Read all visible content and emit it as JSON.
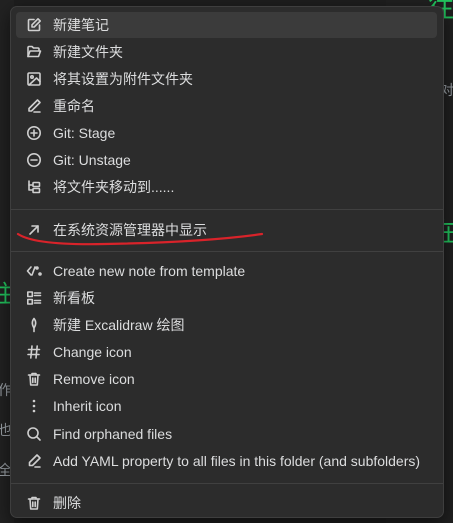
{
  "colors": {
    "menu_bg": "#2c2c2c",
    "hover_bg": "#3b3b3b",
    "text": "#dcddde",
    "separator": "#404040",
    "annotation": "#d9232a",
    "background_green": "#22c55e"
  },
  "background": {
    "glyph_top": "往",
    "glyph_mid_right": "在",
    "glyph_left": "住",
    "snippet_right": "对",
    "snippet_left_1": "作",
    "snippet_left_2": "也",
    "snippet_left_3": "全"
  },
  "menu": {
    "items": [
      {
        "label": "新建笔记",
        "icon": "edit-icon"
      },
      {
        "label": "新建文件夹",
        "icon": "folder-open-icon"
      },
      {
        "label": "将其设置为附件文件夹",
        "icon": "image-icon"
      },
      {
        "label": "重命名",
        "icon": "pencil-icon"
      },
      {
        "label": "Git: Stage",
        "icon": "plus-circle-icon"
      },
      {
        "label": "Git: Unstage",
        "icon": "minus-circle-icon"
      },
      {
        "label": "将文件夹移动到......",
        "icon": "folder-tree-icon"
      },
      {
        "label": "在系统资源管理器中显示",
        "icon": "arrow-up-right-icon"
      },
      {
        "label": "Create new note from template",
        "icon": "template-icon"
      },
      {
        "label": "新看板",
        "icon": "kanban-icon"
      },
      {
        "label": "新建 Excalidraw 绘图",
        "icon": "feather-icon"
      },
      {
        "label": "Change icon",
        "icon": "hash-icon"
      },
      {
        "label": "Remove icon",
        "icon": "trash-icon"
      },
      {
        "label": "Inherit icon",
        "icon": "vertical-dots-icon"
      },
      {
        "label": "Find orphaned files",
        "icon": "search-icon"
      },
      {
        "label": "Add YAML property to all files in this folder (and subfolders)",
        "icon": "pen-line-icon"
      },
      {
        "label": "删除",
        "icon": "trash-icon"
      }
    ]
  }
}
